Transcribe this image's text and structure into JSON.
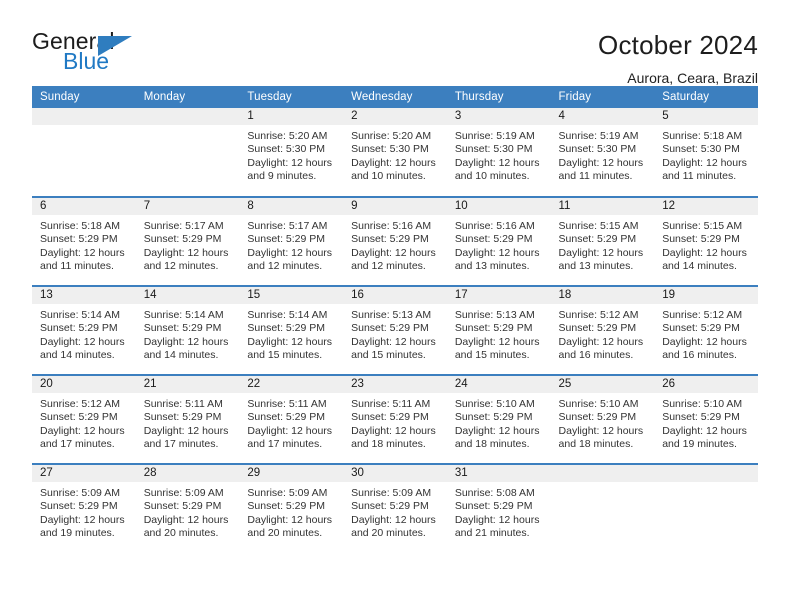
{
  "brand": {
    "name_top": "General",
    "name_bottom": "Blue",
    "triangle_color": "#2f7dbf",
    "text_color": "#1c1c1c",
    "blue_color": "#2079c4"
  },
  "header": {
    "title": "October 2024",
    "subtitle": "Aurora, Ceara, Brazil"
  },
  "theme": {
    "header_bg": "#3c7fbf",
    "header_text": "#ffffff",
    "daynum_band_bg": "#efefef",
    "row_divider": "#3c7fbf"
  },
  "weekday_headers": [
    "Sunday",
    "Monday",
    "Tuesday",
    "Wednesday",
    "Thursday",
    "Friday",
    "Saturday"
  ],
  "weeks": [
    [
      {
        "day": "",
        "empty": true,
        "sunrise": "",
        "sunset": "",
        "daylight_line1": "",
        "daylight_line2": ""
      },
      {
        "day": "",
        "empty": true,
        "sunrise": "",
        "sunset": "",
        "daylight_line1": "",
        "daylight_line2": ""
      },
      {
        "day": "1",
        "sunrise": "Sunrise: 5:20 AM",
        "sunset": "Sunset: 5:30 PM",
        "daylight_line1": "Daylight: 12 hours",
        "daylight_line2": "and 9 minutes."
      },
      {
        "day": "2",
        "sunrise": "Sunrise: 5:20 AM",
        "sunset": "Sunset: 5:30 PM",
        "daylight_line1": "Daylight: 12 hours",
        "daylight_line2": "and 10 minutes."
      },
      {
        "day": "3",
        "sunrise": "Sunrise: 5:19 AM",
        "sunset": "Sunset: 5:30 PM",
        "daylight_line1": "Daylight: 12 hours",
        "daylight_line2": "and 10 minutes."
      },
      {
        "day": "4",
        "sunrise": "Sunrise: 5:19 AM",
        "sunset": "Sunset: 5:30 PM",
        "daylight_line1": "Daylight: 12 hours",
        "daylight_line2": "and 11 minutes."
      },
      {
        "day": "5",
        "sunrise": "Sunrise: 5:18 AM",
        "sunset": "Sunset: 5:30 PM",
        "daylight_line1": "Daylight: 12 hours",
        "daylight_line2": "and 11 minutes."
      }
    ],
    [
      {
        "day": "6",
        "sunrise": "Sunrise: 5:18 AM",
        "sunset": "Sunset: 5:29 PM",
        "daylight_line1": "Daylight: 12 hours",
        "daylight_line2": "and 11 minutes."
      },
      {
        "day": "7",
        "sunrise": "Sunrise: 5:17 AM",
        "sunset": "Sunset: 5:29 PM",
        "daylight_line1": "Daylight: 12 hours",
        "daylight_line2": "and 12 minutes."
      },
      {
        "day": "8",
        "sunrise": "Sunrise: 5:17 AM",
        "sunset": "Sunset: 5:29 PM",
        "daylight_line1": "Daylight: 12 hours",
        "daylight_line2": "and 12 minutes."
      },
      {
        "day": "9",
        "sunrise": "Sunrise: 5:16 AM",
        "sunset": "Sunset: 5:29 PM",
        "daylight_line1": "Daylight: 12 hours",
        "daylight_line2": "and 12 minutes."
      },
      {
        "day": "10",
        "sunrise": "Sunrise: 5:16 AM",
        "sunset": "Sunset: 5:29 PM",
        "daylight_line1": "Daylight: 12 hours",
        "daylight_line2": "and 13 minutes."
      },
      {
        "day": "11",
        "sunrise": "Sunrise: 5:15 AM",
        "sunset": "Sunset: 5:29 PM",
        "daylight_line1": "Daylight: 12 hours",
        "daylight_line2": "and 13 minutes."
      },
      {
        "day": "12",
        "sunrise": "Sunrise: 5:15 AM",
        "sunset": "Sunset: 5:29 PM",
        "daylight_line1": "Daylight: 12 hours",
        "daylight_line2": "and 14 minutes."
      }
    ],
    [
      {
        "day": "13",
        "sunrise": "Sunrise: 5:14 AM",
        "sunset": "Sunset: 5:29 PM",
        "daylight_line1": "Daylight: 12 hours",
        "daylight_line2": "and 14 minutes."
      },
      {
        "day": "14",
        "sunrise": "Sunrise: 5:14 AM",
        "sunset": "Sunset: 5:29 PM",
        "daylight_line1": "Daylight: 12 hours",
        "daylight_line2": "and 14 minutes."
      },
      {
        "day": "15",
        "sunrise": "Sunrise: 5:14 AM",
        "sunset": "Sunset: 5:29 PM",
        "daylight_line1": "Daylight: 12 hours",
        "daylight_line2": "and 15 minutes."
      },
      {
        "day": "16",
        "sunrise": "Sunrise: 5:13 AM",
        "sunset": "Sunset: 5:29 PM",
        "daylight_line1": "Daylight: 12 hours",
        "daylight_line2": "and 15 minutes."
      },
      {
        "day": "17",
        "sunrise": "Sunrise: 5:13 AM",
        "sunset": "Sunset: 5:29 PM",
        "daylight_line1": "Daylight: 12 hours",
        "daylight_line2": "and 15 minutes."
      },
      {
        "day": "18",
        "sunrise": "Sunrise: 5:12 AM",
        "sunset": "Sunset: 5:29 PM",
        "daylight_line1": "Daylight: 12 hours",
        "daylight_line2": "and 16 minutes."
      },
      {
        "day": "19",
        "sunrise": "Sunrise: 5:12 AM",
        "sunset": "Sunset: 5:29 PM",
        "daylight_line1": "Daylight: 12 hours",
        "daylight_line2": "and 16 minutes."
      }
    ],
    [
      {
        "day": "20",
        "sunrise": "Sunrise: 5:12 AM",
        "sunset": "Sunset: 5:29 PM",
        "daylight_line1": "Daylight: 12 hours",
        "daylight_line2": "and 17 minutes."
      },
      {
        "day": "21",
        "sunrise": "Sunrise: 5:11 AM",
        "sunset": "Sunset: 5:29 PM",
        "daylight_line1": "Daylight: 12 hours",
        "daylight_line2": "and 17 minutes."
      },
      {
        "day": "22",
        "sunrise": "Sunrise: 5:11 AM",
        "sunset": "Sunset: 5:29 PM",
        "daylight_line1": "Daylight: 12 hours",
        "daylight_line2": "and 17 minutes."
      },
      {
        "day": "23",
        "sunrise": "Sunrise: 5:11 AM",
        "sunset": "Sunset: 5:29 PM",
        "daylight_line1": "Daylight: 12 hours",
        "daylight_line2": "and 18 minutes."
      },
      {
        "day": "24",
        "sunrise": "Sunrise: 5:10 AM",
        "sunset": "Sunset: 5:29 PM",
        "daylight_line1": "Daylight: 12 hours",
        "daylight_line2": "and 18 minutes."
      },
      {
        "day": "25",
        "sunrise": "Sunrise: 5:10 AM",
        "sunset": "Sunset: 5:29 PM",
        "daylight_line1": "Daylight: 12 hours",
        "daylight_line2": "and 18 minutes."
      },
      {
        "day": "26",
        "sunrise": "Sunrise: 5:10 AM",
        "sunset": "Sunset: 5:29 PM",
        "daylight_line1": "Daylight: 12 hours",
        "daylight_line2": "and 19 minutes."
      }
    ],
    [
      {
        "day": "27",
        "sunrise": "Sunrise: 5:09 AM",
        "sunset": "Sunset: 5:29 PM",
        "daylight_line1": "Daylight: 12 hours",
        "daylight_line2": "and 19 minutes."
      },
      {
        "day": "28",
        "sunrise": "Sunrise: 5:09 AM",
        "sunset": "Sunset: 5:29 PM",
        "daylight_line1": "Daylight: 12 hours",
        "daylight_line2": "and 20 minutes."
      },
      {
        "day": "29",
        "sunrise": "Sunrise: 5:09 AM",
        "sunset": "Sunset: 5:29 PM",
        "daylight_line1": "Daylight: 12 hours",
        "daylight_line2": "and 20 minutes."
      },
      {
        "day": "30",
        "sunrise": "Sunrise: 5:09 AM",
        "sunset": "Sunset: 5:29 PM",
        "daylight_line1": "Daylight: 12 hours",
        "daylight_line2": "and 20 minutes."
      },
      {
        "day": "31",
        "sunrise": "Sunrise: 5:08 AM",
        "sunset": "Sunset: 5:29 PM",
        "daylight_line1": "Daylight: 12 hours",
        "daylight_line2": "and 21 minutes."
      },
      {
        "day": "",
        "empty": true,
        "sunrise": "",
        "sunset": "",
        "daylight_line1": "",
        "daylight_line2": ""
      },
      {
        "day": "",
        "empty": true,
        "sunrise": "",
        "sunset": "",
        "daylight_line1": "",
        "daylight_line2": ""
      }
    ]
  ]
}
